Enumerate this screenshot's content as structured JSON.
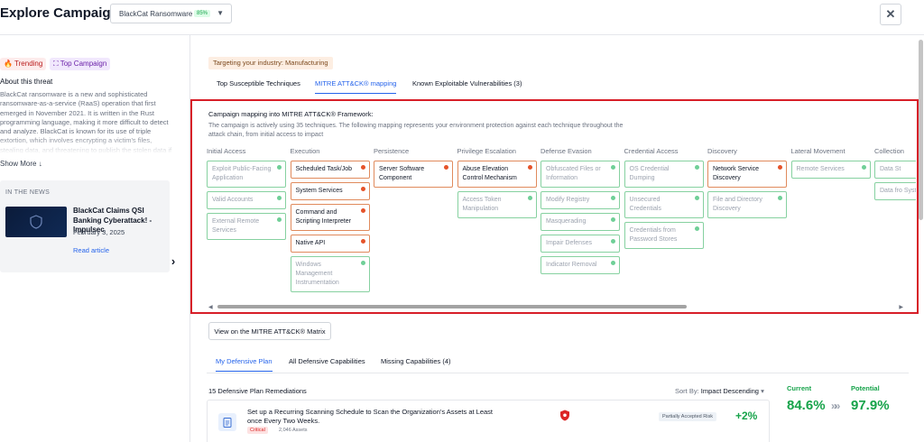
{
  "header": {
    "title": "Explore Campaigns:",
    "campaign_name": "BlackCat Ransomware",
    "campaign_badge": "85%",
    "close_label": "✕"
  },
  "sidebar": {
    "tags": [
      "Trending",
      "Top Campaign"
    ],
    "about_title": "About this threat",
    "about_text": "BlackCat ransomware is a new and sophisticated ransomware-as-a-service (RaaS) operation that first emerged in November 2021. It is written in the Rust programming language, making it more difficult to detect and analyze. BlackCat is known for its use of triple extortion, which involves encrypting a victim's files, stealing data, and threatening to publish the stolen data if the",
    "show_more": "Show More",
    "news": {
      "header": "IN THE NEWS",
      "title": "BlackCat Claims QSI Banking Cyberattack! - Impulsec",
      "date": "February 3, 2025",
      "link": "Read article"
    }
  },
  "main": {
    "industry": "Targeting your industry: Manufacturing",
    "tabs": [
      "Top Susceptible Techniques",
      "MITRE ATT&CK® mapping",
      "Known Exploitable Vulnerabilities (3)"
    ],
    "mitre": {
      "title": "Campaign mapping into MITRE ATT&CK® Framework:",
      "description": "The campaign is actively using 35 techniques. The following mapping represents your environment protection against each technique throughout the attack chain, from initial access to impact",
      "tactics": [
        {
          "name": "Initial Access",
          "techniques": [
            {
              "label": "Exploit Public-Facing Application",
              "status": "protected"
            },
            {
              "label": "Valid Accounts",
              "status": "protected"
            },
            {
              "label": "External Remote Services",
              "status": "protected"
            }
          ]
        },
        {
          "name": "Execution",
          "techniques": [
            {
              "label": "Scheduled Task/Job",
              "status": "exposed"
            },
            {
              "label": "System Services",
              "status": "exposed"
            },
            {
              "label": "Command and Scripting Interpreter",
              "status": "exposed"
            },
            {
              "label": "Native API",
              "status": "exposed"
            },
            {
              "label": "Windows Management Instrumentation",
              "status": "protected"
            }
          ]
        },
        {
          "name": "Persistence",
          "techniques": [
            {
              "label": "Server Software Component",
              "status": "exposed"
            }
          ]
        },
        {
          "name": "Privilege Escalation",
          "techniques": [
            {
              "label": "Abuse Elevation Control Mechanism",
              "status": "exposed"
            },
            {
              "label": "Access Token Manipulation",
              "status": "protected"
            }
          ]
        },
        {
          "name": "Defense Evasion",
          "techniques": [
            {
              "label": "Obfuscated Files or Information",
              "status": "protected"
            },
            {
              "label": "Modify Registry",
              "status": "protected"
            },
            {
              "label": "Masquerading",
              "status": "protected"
            },
            {
              "label": "Impair Defenses",
              "status": "protected"
            },
            {
              "label": "Indicator Removal",
              "status": "protected"
            }
          ]
        },
        {
          "name": "Credential Access",
          "techniques": [
            {
              "label": "OS Credential Dumping",
              "status": "protected"
            },
            {
              "label": "Unsecured Credentials",
              "status": "protected"
            },
            {
              "label": "Credentials from Password Stores",
              "status": "protected"
            }
          ]
        },
        {
          "name": "Discovery",
          "techniques": [
            {
              "label": "Network Service Discovery",
              "status": "exposed"
            },
            {
              "label": "File and Directory Discovery",
              "status": "protected"
            }
          ]
        },
        {
          "name": "Lateral Movement",
          "techniques": [
            {
              "label": "Remote Services",
              "status": "protected"
            }
          ]
        },
        {
          "name": "Collection",
          "techniques": [
            {
              "label": "Data St",
              "status": "protected"
            },
            {
              "label": "Data fro System",
              "status": "protected"
            }
          ]
        }
      ]
    },
    "matrix_button": "View on the MITRE ATT&CK® Matrix",
    "plan_tabs": [
      "My Defensive Plan",
      "All Defensive Capabilities",
      "Missing Capabilities (4)"
    ],
    "plan_count": "15 Defensive Plan Remediations",
    "sort_label": "Sort By:",
    "sort_value": "Impact Descending",
    "remediation": {
      "title": "Set up a Recurring Scanning Schedule to Scan the Organization's Assets at Least once Every Two Weeks.",
      "severity": "Critical",
      "assets": "2,046 Assets",
      "status": "Partially Accepted Risk",
      "gain": "+2%"
    },
    "score": {
      "current_label": "Current",
      "potential_label": "Potential",
      "current": "84.6%",
      "potential": "97.9%",
      "arrow": "»»"
    }
  },
  "colors": {
    "accent": "#2563eb",
    "exposed": "#e5532a",
    "protected": "#6fcf97",
    "highlight_border": "#d71e28",
    "score_green": "#16a34a"
  }
}
